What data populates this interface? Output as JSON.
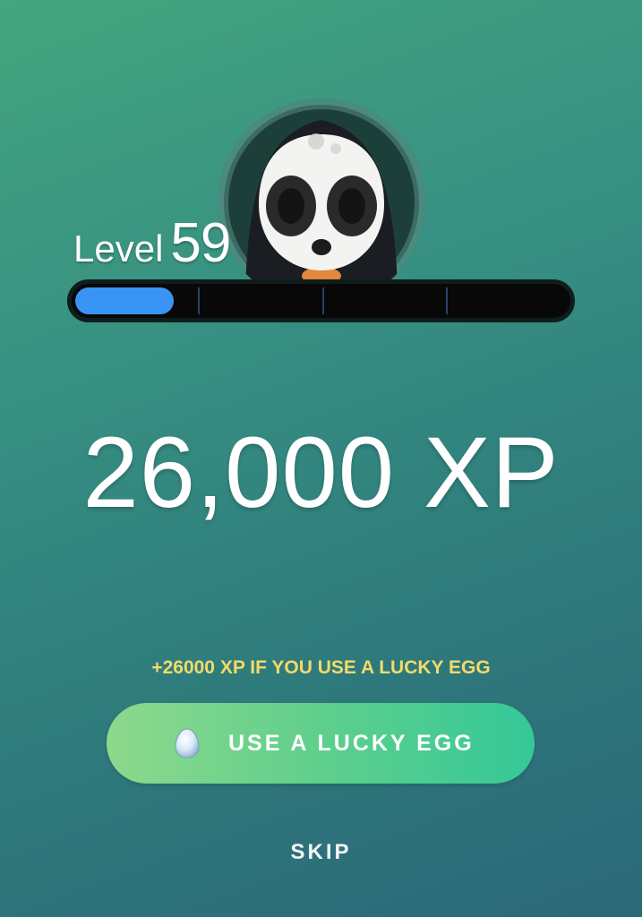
{
  "player": {
    "level_word": "Level",
    "level_number": "59"
  },
  "progress": {
    "fraction": 0.2,
    "segments": 4
  },
  "reward": {
    "xp_text": "26,000 XP"
  },
  "lucky_egg": {
    "hint": "+26000 XP IF YOU USE A LUCKY EGG",
    "button_label": "USE A LUCKY EGG",
    "icon": "lucky-egg-icon"
  },
  "skip": {
    "label": "SKIP"
  },
  "colors": {
    "bar_fill": "#3a94f5",
    "hint_text": "#f3da6a",
    "button_start": "#8dd98c",
    "button_end": "#35c898"
  }
}
